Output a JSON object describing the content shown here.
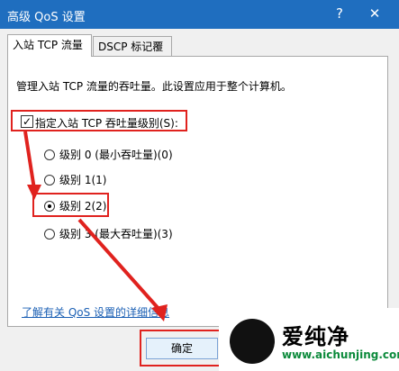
{
  "window": {
    "title": "高级 QoS 设置",
    "help": "?",
    "close": "✕"
  },
  "tabs": [
    {
      "label": "入站 TCP 流量"
    },
    {
      "label": "DSCP 标记覆盖"
    }
  ],
  "panel": {
    "description": "管理入站 TCP 流量的吞吐量。此设置应用于整个计算机。",
    "checkbox": {
      "label": "指定入站 TCP 吞吐量级别(S):",
      "checked": true,
      "mark": "✓"
    },
    "radios": [
      {
        "label": "级别 0 (最小吞吐量)(0)",
        "selected": false
      },
      {
        "label": "级别 1(1)",
        "selected": false
      },
      {
        "label": "级别 2(2)",
        "selected": true
      },
      {
        "label": "级别 3 (最大吞吐量)(3)",
        "selected": false
      }
    ],
    "link": "了解有关 QoS 设置的详细信息"
  },
  "buttons": {
    "ok": "确定"
  },
  "watermark": {
    "text": "爱纯净",
    "url": "www.aichunjing.com"
  },
  "colors": {
    "titlebar": "#1f6ebf",
    "annotation_red": "#e0221e",
    "watermark_green": "#0b8a3b"
  }
}
